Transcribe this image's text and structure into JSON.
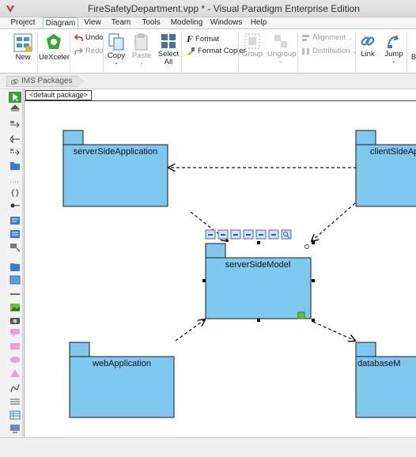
{
  "window": {
    "title": "FireSafetyDepartment.vpp * - Visual Paradigm Enterprise Edition"
  },
  "menu": [
    "Project",
    "Diagram",
    "View",
    "Team",
    "Tools",
    "Modeling",
    "Windows",
    "Help"
  ],
  "menu_active": "Diagram",
  "ribbon": {
    "new": "New",
    "uexceler": "UeXceler",
    "undo": "Undo",
    "redo": "Redo",
    "copy": "Copy",
    "paste": "Paste",
    "select": "Select",
    "select_sub": "All",
    "format": "Format",
    "format_copier": "Format Copier",
    "group": "Group",
    "ungroup": "Ungroup",
    "alignment": "Alignment",
    "distribution": "Distribution",
    "link": "Link",
    "jump": "Jump",
    "next_partial": "B"
  },
  "breadcrumb": "IMS Packages",
  "package_tab": "<default package>",
  "diagram": {
    "packages": [
      {
        "name": "serverSideApplication"
      },
      {
        "name": "clientSideAp"
      },
      {
        "name": "serverSideModel"
      },
      {
        "name": "webApplication"
      },
      {
        "name": "databaseM"
      }
    ]
  },
  "colors": {
    "package_fill": "#7ec8f0",
    "package_stroke": "#1a1a1a",
    "ribbon_accent": "#9cb7d6"
  }
}
